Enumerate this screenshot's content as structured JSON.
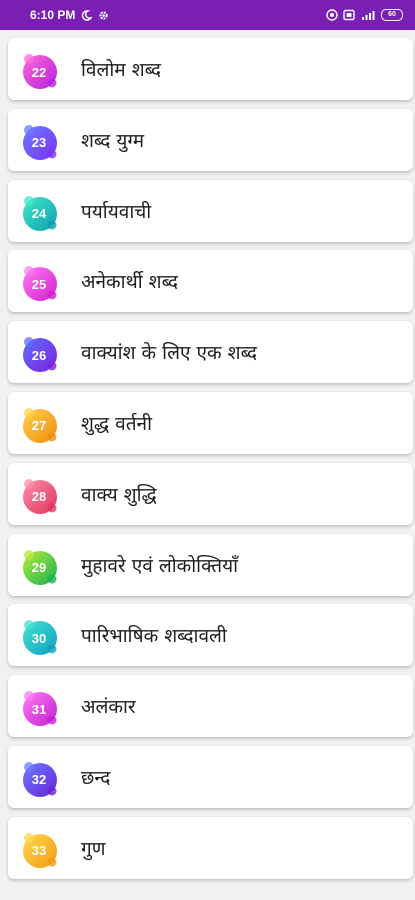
{
  "status_bar": {
    "time": "6:10 PM",
    "icons": [
      "moon-icon",
      "gear-icon",
      "hotspot-icon",
      "screen-cast-icon",
      "signal-icon",
      "battery-icon"
    ],
    "battery_text": "60",
    "background": "#7a1fb3"
  },
  "items": [
    {
      "number": "22",
      "label": "विलोम शब्द",
      "color1": "#ff6ad5",
      "color2": "#b620e0"
    },
    {
      "number": "23",
      "label": "शब्द युग्म",
      "color1": "#6a7bff",
      "color2": "#7b2ff7"
    },
    {
      "number": "24",
      "label": "पर्यायवाची",
      "color1": "#3ee8c8",
      "color2": "#0f9fb0"
    },
    {
      "number": "25",
      "label": "अनेकार्थी शब्द",
      "color1": "#ff7bf2",
      "color2": "#d31fd0"
    },
    {
      "number": "26",
      "label": "वाक्यांश के लिए एक शब्द",
      "color1": "#5f6dff",
      "color2": "#7b22d8"
    },
    {
      "number": "27",
      "label": "शुद्ध वर्तनी",
      "color1": "#ffd14a",
      "color2": "#f08c10"
    },
    {
      "number": "28",
      "label": "वाक्य शुद्धि",
      "color1": "#ff8fa8",
      "color2": "#e0335e"
    },
    {
      "number": "29",
      "label": "मुहावरे एवं लोकोक्तियाँ",
      "color1": "#b6ea3a",
      "color2": "#17b350"
    },
    {
      "number": "30",
      "label": "पारिभाषिक शब्दावली",
      "color1": "#42e3d0",
      "color2": "#119fbf"
    },
    {
      "number": "31",
      "label": "अलंकार",
      "color1": "#ff7cf0",
      "color2": "#c41ed4"
    },
    {
      "number": "32",
      "label": "छन्द",
      "color1": "#6b7cff",
      "color2": "#6a23d6"
    },
    {
      "number": "33",
      "label": "गुण",
      "color1": "#ffd84f",
      "color2": "#f29a12"
    }
  ]
}
